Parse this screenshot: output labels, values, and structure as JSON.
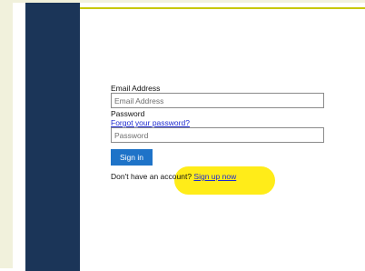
{
  "signin": {
    "email_label": "Email Address",
    "email_placeholder": "Email Address",
    "email_value": "",
    "password_label": "Password",
    "forgot_link": "Forgot your password?",
    "password_placeholder": "Password",
    "password_value": "",
    "submit_label": "Sign in",
    "signup_prompt": "Don't have an account?",
    "signup_link": "Sign up now"
  },
  "colors": {
    "side_panel": "#1b3558",
    "button": "#1e73c8",
    "link": "#1f2bd1",
    "highlight": "#ffea00",
    "frame_border": "#c8c800"
  }
}
